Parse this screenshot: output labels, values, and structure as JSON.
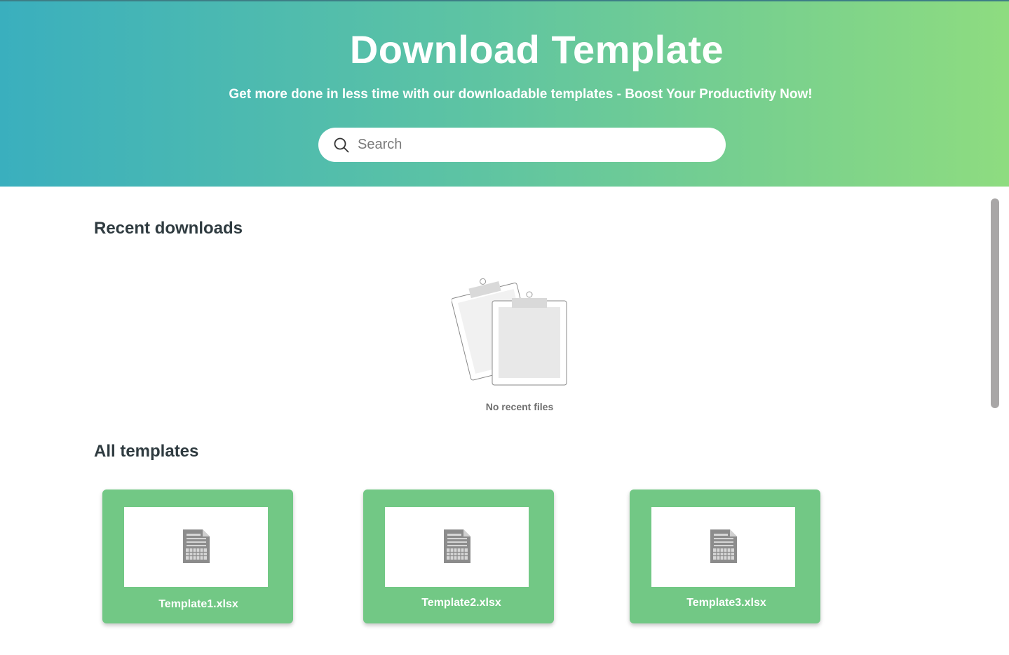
{
  "hero": {
    "title": "Download Template",
    "subtitle": "Get more done in less time with our downloadable templates - Boost Your Productivity Now!",
    "gradient_start": "#3aafbe",
    "gradient_end": "#8edc80"
  },
  "search": {
    "placeholder": "Search",
    "value": "",
    "icon": "search-icon"
  },
  "recent": {
    "title": "Recent downloads",
    "empty_text": "No recent files",
    "empty_icon": "clipboard-icon"
  },
  "templates": {
    "title": "All templates",
    "card_color": "#72c885",
    "items": [
      {
        "label": "Template1.xlsx",
        "icon": "spreadsheet-file-icon"
      },
      {
        "label": "Template2.xlsx",
        "icon": "spreadsheet-file-icon"
      },
      {
        "label": "Template3.xlsx",
        "icon": "spreadsheet-file-icon"
      }
    ]
  }
}
